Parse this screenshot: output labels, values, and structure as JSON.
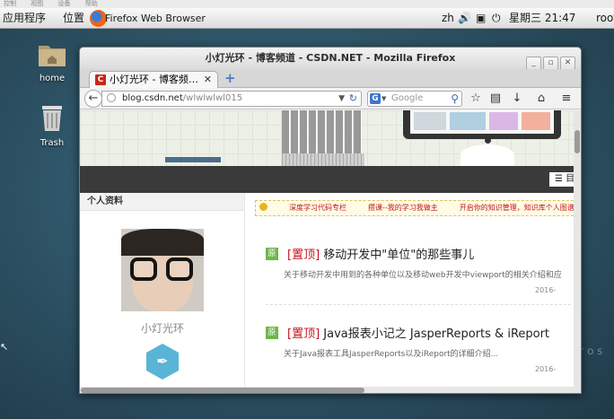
{
  "host_menu": [
    "控制",
    "视图",
    "设备",
    "帮助"
  ],
  "panel": {
    "apps": "应用程序",
    "places": "位置",
    "active_app": "Firefox Web Browser",
    "lang": "zh",
    "clock": "星期三 21:47",
    "user": "root"
  },
  "desktop": {
    "home_label": "home",
    "trash_label": "Trash",
    "watermark": "CENTOS"
  },
  "window": {
    "title": "小灯光环 - 博客频道 - CSDN.NET - Mozilla Firefox",
    "tab_label": "小灯光环 - 博客频…",
    "tab_favicon": "C",
    "url_domain": "blog.csdn.net",
    "url_path": "/wlwlwlwl015",
    "search_placeholder": "Google",
    "search_engine": "G"
  },
  "page": {
    "menu_button": "☰ 目",
    "profile_heading": "个人资料",
    "author": "小灯光环",
    "notice": [
      "深度学习代码专栏",
      "攒课--我的学习我做主",
      "开启你的知识管理，知识库个人图谱上线"
    ],
    "posts": [
      {
        "badge": "原",
        "pin": "[置顶]",
        "title": "移动开发中\"单位\"的那些事儿",
        "summary": "关于移动开发中用到的各种单位以及移动web开发中viewport的相关介绍和应",
        "date": "2016-"
      },
      {
        "badge": "原",
        "pin": "[置顶]",
        "title": "Java报表小记之 JasperReports & iReport",
        "summary": "关于Java报表工具JasperReports以及iReport的详细介绍...",
        "date": "2016-"
      }
    ]
  },
  "colors": {
    "pin_red": "#c0151d",
    "badge_green": "#6fb64b",
    "avatar_badge": "#5ab4d6"
  }
}
